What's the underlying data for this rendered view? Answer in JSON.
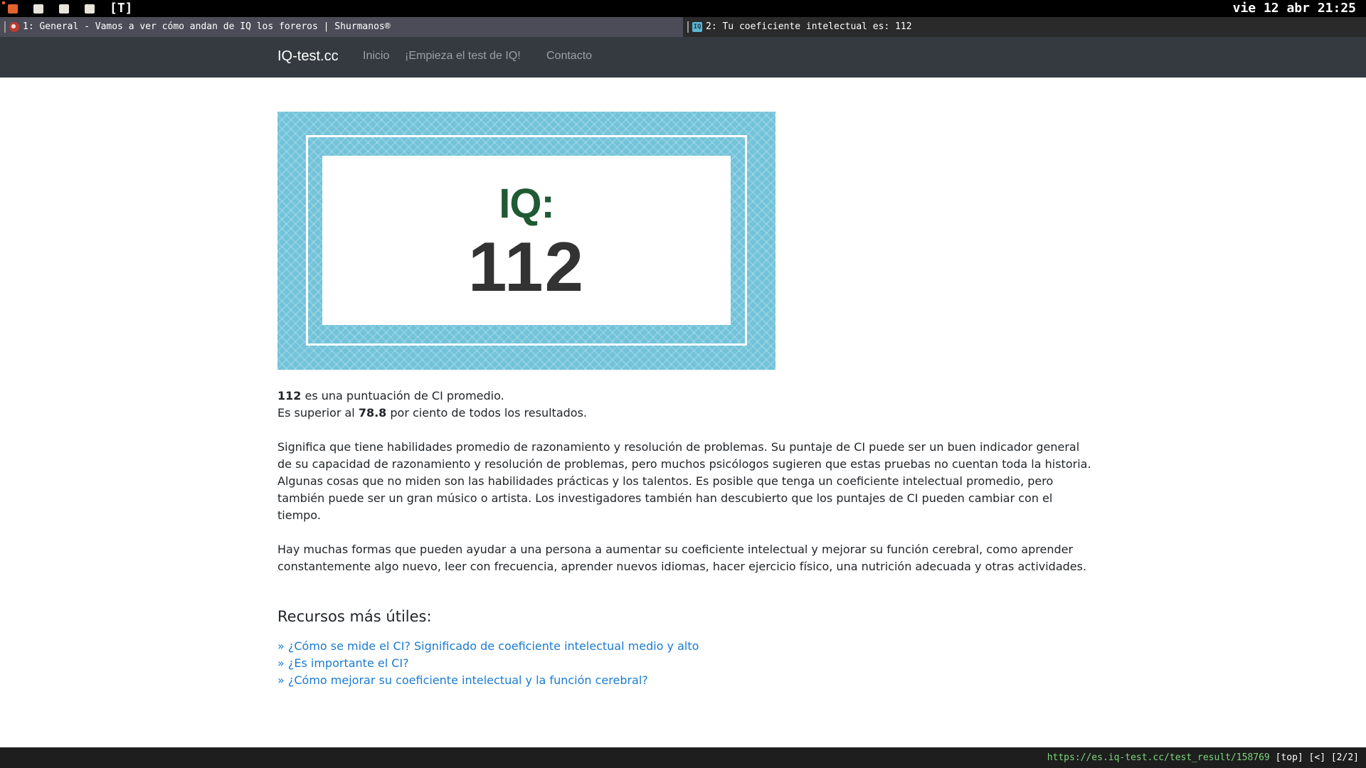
{
  "system_bar": {
    "layout_indicator": "[T]",
    "clock": "vie 12 abr 21:25"
  },
  "tabs": [
    {
      "label": "1: General - Vamos a ver cómo andan de IQ los foreros | Shurmanos®",
      "active": true,
      "favicon": "shurmanos-favicon"
    },
    {
      "label": "2: Tu coeficiente intelectual es: 112",
      "active": false,
      "favicon": "iq-favicon"
    }
  ],
  "navbar": {
    "brand": "IQ-test.cc",
    "links": [
      "Inicio",
      "¡Empieza el test de IQ!",
      "Contacto"
    ]
  },
  "badge": {
    "label": "IQ:",
    "score": "112",
    "background_color": "#72c3d9",
    "label_color": "#1f5a33"
  },
  "result": {
    "score": "112",
    "line1_rest": " es una puntuación de CI promedio.",
    "line2_pre": "Es superior al ",
    "percentile": "78.8",
    "line2_post": " por ciento de todos los resultados."
  },
  "paragraphs": [
    "Significa que tiene habilidades promedio de razonamiento y resolución de problemas. Su puntaje de CI puede ser un buen indicador general de su capacidad de razonamiento y resolución de problemas, pero muchos psicólogos sugieren que estas pruebas no cuentan toda la historia. Algunas cosas que no miden son las habilidades prácticas y los talentos. Es posible que tenga un coeficiente intelectual promedio, pero también puede ser un gran músico o artista. Los investigadores también han descubierto que los puntajes de CI pueden cambiar con el tiempo.",
    "Hay muchas formas que pueden ayudar a una persona a aumentar su coeficiente intelectual y mejorar su función cerebral, como aprender constantemente algo nuevo, leer con frecuencia, aprender nuevos idiomas, hacer ejercicio físico, una nutrición adecuada y otras actividades."
  ],
  "resources": {
    "title": "Recursos más útiles:",
    "links": [
      "» ¿Cómo se mide el CI? Significado de coeficiente intelectual medio y alto",
      "» ¿Es importante el CI?",
      "» ¿Cómo mejorar su coeficiente intelectual y la función cerebral?"
    ]
  },
  "status_bar": {
    "url": "https://es.iq-test.cc/test_result/158769",
    "info": " [top] [<] [2/2]"
  },
  "colors": {
    "navbar_bg": "#343a40",
    "link": "#1a7bd1",
    "url_green": "#7cd67c"
  }
}
